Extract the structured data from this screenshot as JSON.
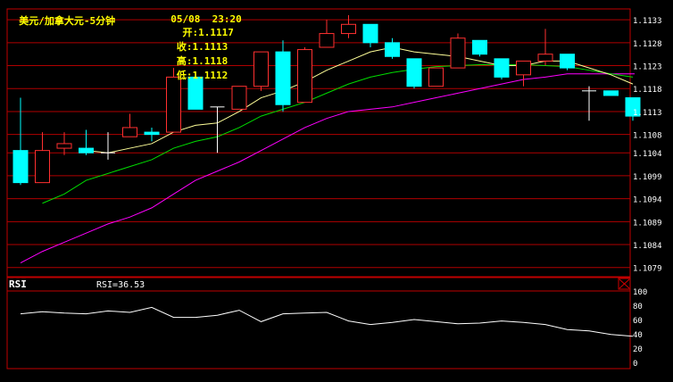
{
  "header": {
    "title": "美元/加拿大元-5分钟",
    "datetime": "05/08  23:20",
    "open_label": "开:",
    "open_value": "1.1117",
    "close_label": "收:",
    "close_value": "1.1113",
    "high_label": "高:",
    "high_value": "1.1118",
    "low_label": "低:",
    "low_value": "1.1112"
  },
  "rsi_panel": {
    "title": "RSI",
    "value_text": "RSI=36.53"
  },
  "colors": {
    "background": "#000000",
    "grid": "#b00000",
    "frame": "#c00000",
    "up_candle": "#ff3030",
    "down_candle": "#00ffff",
    "ma_short": "#ffff99",
    "ma_mid": "#00dd00",
    "ma_long": "#ff00ff",
    "rsi_line": "#ffffff",
    "title": "#ffff00",
    "axis_text": "#ffffff"
  },
  "chart_data": [
    {
      "type": "candlestick",
      "title": "美元/加拿大元-5分钟",
      "ylim": [
        1.1077,
        1.1134
      ],
      "y_ticks": [
        "1.1133",
        "1.1128",
        "1.1123",
        "1.1118",
        "1.1113",
        "1.1108",
        "1.1104",
        "1.1099",
        "1.1094",
        "1.1089",
        "1.1084",
        "1.1079"
      ],
      "candles": [
        {
          "o": 1.11045,
          "h": 1.1116,
          "l": 1.1097,
          "c": 1.10975
        },
        {
          "o": 1.10975,
          "h": 1.11085,
          "l": 1.10975,
          "c": 1.11045
        },
        {
          "o": 1.1105,
          "h": 1.11085,
          "l": 1.11035,
          "c": 1.1106
        },
        {
          "o": 1.1105,
          "h": 1.1109,
          "l": 1.11035,
          "c": 1.1104
        },
        {
          "o": 1.1104,
          "h": 1.11085,
          "l": 1.11025,
          "c": 1.1104
        },
        {
          "o": 1.11075,
          "h": 1.11125,
          "l": 1.11075,
          "c": 1.11095
        },
        {
          "o": 1.11085,
          "h": 1.11095,
          "l": 1.11065,
          "c": 1.1108
        },
        {
          "o": 1.11085,
          "h": 1.11225,
          "l": 1.11085,
          "c": 1.11205
        },
        {
          "o": 1.11205,
          "h": 1.1121,
          "l": 1.11135,
          "c": 1.11135
        },
        {
          "o": 1.1114,
          "h": 1.1114,
          "l": 1.1104,
          "c": 1.1114
        },
        {
          "o": 1.11135,
          "h": 1.11185,
          "l": 1.11135,
          "c": 1.11185
        },
        {
          "o": 1.11185,
          "h": 1.1126,
          "l": 1.11175,
          "c": 1.1126
        },
        {
          "o": 1.1126,
          "h": 1.11285,
          "l": 1.1113,
          "c": 1.11145
        },
        {
          "o": 1.1115,
          "h": 1.1127,
          "l": 1.1115,
          "c": 1.11265
        },
        {
          "o": 1.1127,
          "h": 1.1133,
          "l": 1.1127,
          "c": 1.113
        },
        {
          "o": 1.113,
          "h": 1.1134,
          "l": 1.1129,
          "c": 1.1132
        },
        {
          "o": 1.1132,
          "h": 1.1132,
          "l": 1.1127,
          "c": 1.1128
        },
        {
          "o": 1.1128,
          "h": 1.1129,
          "l": 1.11245,
          "c": 1.1125
        },
        {
          "o": 1.11245,
          "h": 1.11245,
          "l": 1.1118,
          "c": 1.11185
        },
        {
          "o": 1.11185,
          "h": 1.11225,
          "l": 1.11185,
          "c": 1.11225
        },
        {
          "o": 1.11225,
          "h": 1.113,
          "l": 1.11225,
          "c": 1.1129
        },
        {
          "o": 1.11285,
          "h": 1.11285,
          "l": 1.1125,
          "c": 1.11255
        },
        {
          "o": 1.11245,
          "h": 1.11245,
          "l": 1.112,
          "c": 1.11205
        },
        {
          "o": 1.1121,
          "h": 1.1124,
          "l": 1.11185,
          "c": 1.1124
        },
        {
          "o": 1.1124,
          "h": 1.1131,
          "l": 1.1123,
          "c": 1.11255
        },
        {
          "o": 1.11255,
          "h": 1.11255,
          "l": 1.1122,
          "c": 1.11225
        },
        {
          "o": 1.11175,
          "h": 1.11185,
          "l": 1.1111,
          "c": 1.11175
        },
        {
          "o": 1.11175,
          "h": 1.11175,
          "l": 1.11165,
          "c": 1.11165
        },
        {
          "o": 1.1116,
          "h": 1.1116,
          "l": 1.1111,
          "c": 1.1112
        }
      ],
      "ma_short": [
        null,
        null,
        null,
        1.11045,
        1.1104,
        1.1105,
        1.1106,
        1.11085,
        1.111,
        1.11105,
        1.1113,
        1.1116,
        1.11175,
        1.11195,
        1.1122,
        1.1124,
        1.1126,
        1.1127,
        1.1126,
        1.11255,
        1.1125,
        1.1124,
        1.1123,
        1.1123,
        1.1124,
        1.1124,
        1.11225,
        1.1121,
        1.1119
      ],
      "ma_mid": [
        null,
        1.1093,
        1.1095,
        1.1098,
        1.10995,
        1.1101,
        1.11025,
        1.1105,
        1.11065,
        1.11075,
        1.11095,
        1.1112,
        1.11135,
        1.1115,
        1.1117,
        1.1119,
        1.11205,
        1.11215,
        1.11222,
        1.11228,
        1.1123,
        1.11232,
        1.11232,
        1.11232,
        1.1123,
        1.11228,
        1.1122,
        1.11212,
        1.11205
      ],
      "ma_long": [
        1.108,
        1.10825,
        1.10845,
        1.10865,
        1.10885,
        1.109,
        1.1092,
        1.1095,
        1.1098,
        1.11,
        1.1102,
        1.11045,
        1.1107,
        1.11095,
        1.11115,
        1.1113,
        1.11135,
        1.1114,
        1.1115,
        1.1116,
        1.1117,
        1.1118,
        1.1119,
        1.112,
        1.11205,
        1.11212,
        1.11212,
        1.11212,
        null
      ]
    },
    {
      "type": "line",
      "title": "RSI",
      "ylim": [
        0,
        100
      ],
      "y_ticks": [
        "100",
        "80",
        "60",
        "40",
        "20",
        "0"
      ],
      "series": [
        {
          "name": "RSI",
          "values": [
            68,
            71,
            69,
            68,
            72,
            70,
            77,
            63,
            63,
            66,
            73,
            57,
            68,
            69,
            70,
            58,
            53,
            56,
            60,
            57,
            54,
            55,
            58,
            56,
            53,
            46,
            44,
            39,
            36.53
          ]
        }
      ]
    }
  ]
}
